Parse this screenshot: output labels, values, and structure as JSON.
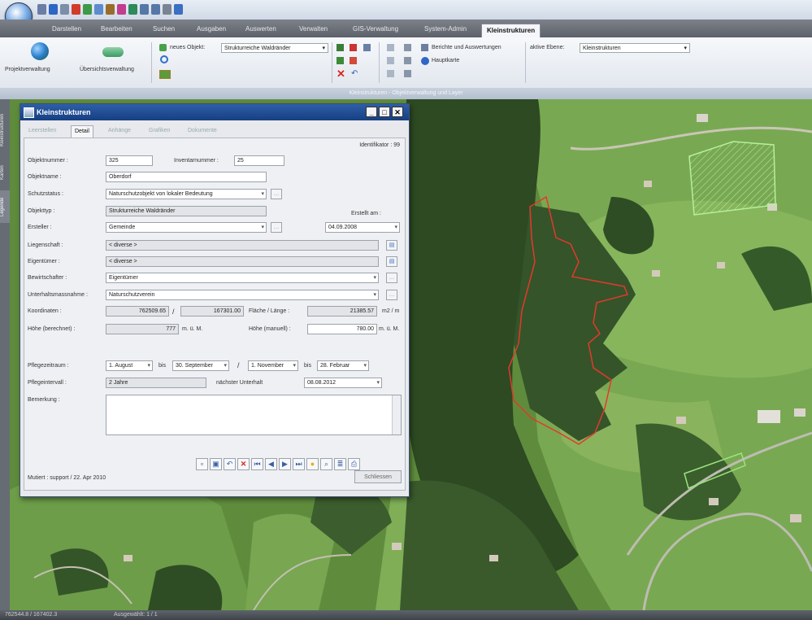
{
  "ribbon": {
    "tabs": [
      "Darstellen",
      "Bearbeiten",
      "Suchen",
      "Ausgaben",
      "Auswerten",
      "Verwalten",
      "GIS-Verwaltung",
      "System-Admin",
      "Kleinstrukturen"
    ],
    "active_tab_index": 8,
    "buttons": {
      "project_admin": "Projektverwaltung",
      "overview": "Übersichtsverwaltung"
    },
    "new_object_label": "neues Objekt:",
    "object_type_value": "Strukturreiche Waldränder",
    "active_layer_label": "aktive Ebene:",
    "active_layer_value": "Kleinstrukturen",
    "reports_label": "Berichte und Auswertungen",
    "basemaps_label": "Hauptkarte",
    "group_caption": "Kleinstrukturen - Objektverwaltung und Layer"
  },
  "side_tabs": [
    "Kleinstrukturen",
    "Karten",
    "Legende"
  ],
  "dialog": {
    "title": "Kleinstrukturen",
    "tabs": [
      "Leerstellen",
      "Detail",
      "Anhänge",
      "Grafiken",
      "Dokumente"
    ],
    "active_tab_index": 1,
    "identifier": "Identifikator : 99",
    "fields": {
      "objektnummer_label": "Objektnummer :",
      "objektnummer": "325",
      "inventarnummer_label": "Inventarnummer :",
      "inventarnummer": "25",
      "objektname_label": "Objektname :",
      "objektname": "Oberdorf",
      "schutzstatus_label": "Schutzstatus :",
      "schutzstatus": "Naturschutzobjekt von lokaler Bedeutung",
      "objekttyp_label": "Objekttyp :",
      "objekttyp": "Strukturreiche Waldränder",
      "erstellt_label": "Erstellt am :",
      "ersteller_label": "Ersteller :",
      "ersteller": "Gemeinde",
      "erstellt": "04.09.2008",
      "liegenschaft_label": "Liegenschaft :",
      "liegenschaft": "< diverse >",
      "eigentuemer_label": "Eigentümer :",
      "eigentuemer": "< diverse >",
      "bewirtschafter_label": "Bewirtschafter :",
      "bewirtschafter": "Eigentümer",
      "unterhalt_label": "Unterhaltsmassnahme :",
      "unterhalt": "Naturschutzverein",
      "koordinaten_label": "Koordinaten :",
      "koord_x": "762509.65",
      "koord_sep": "/",
      "koord_y": "167301.00",
      "flaeche_label": "Fläche / Länge :",
      "flaeche": "21385.57",
      "flaeche_unit": "m2 / m",
      "hoehe_label": "Höhe (berechnet) :",
      "hoehe": "777",
      "hoehe_unit": "m. ü. M.",
      "hoehe_manuell_label": "Höhe (manuell) :",
      "hoehe_manuell": "780.00",
      "hoehe_manuell_unit": "m. ü. M.",
      "pflege_label": "Pflegezeitraum :",
      "pflege1_von": "1. August",
      "bis1": "bis",
      "pflege1_bis": "30. September",
      "pflege_sep": "/",
      "pflege2_von": "1. November",
      "bis2": "bis",
      "pflege2_bis": "28. Februar",
      "intervall_label": "Pflegeintervall :",
      "intervall": "2 Jahre",
      "naechster_label": "nächster Unterhalt",
      "naechster": "08.08.2012",
      "bemerkung_label": "Bemerkung :",
      "bemerkung": ""
    },
    "mutiert": "Mutiert : support / 22. Apr 2010",
    "close_button": "Schliessen"
  },
  "statusbar": {
    "coords": "762544.8 / 167402.3",
    "message": "Ausgewählt: 1 / 1"
  },
  "colors": {
    "title_blue": "#1d4a92",
    "polygon_red": "#e23a2a",
    "polygon_green": "#9be37e"
  }
}
